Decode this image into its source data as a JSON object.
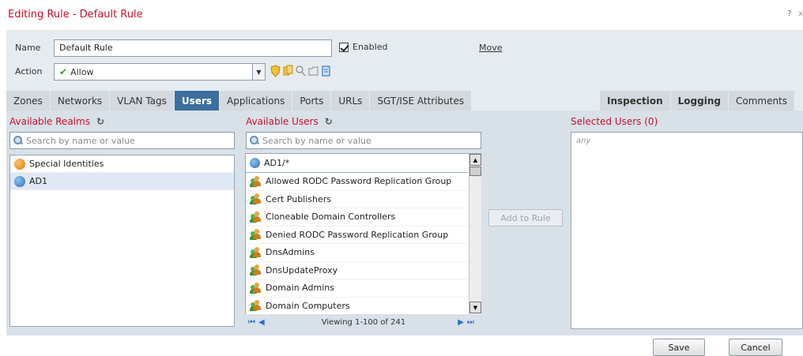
{
  "dialog": {
    "title": "Editing Rule - Default Rule",
    "help": "?",
    "close": "x"
  },
  "form": {
    "name_label": "Name",
    "name_value": "Default Rule",
    "enabled_label": "Enabled",
    "enabled_checked": true,
    "move_label": "Move",
    "action_label": "Action",
    "action_value": "Allow"
  },
  "tabs": {
    "left": [
      "Zones",
      "Networks",
      "VLAN Tags",
      "Users",
      "Applications",
      "Ports",
      "URLs",
      "SGT/ISE Attributes"
    ],
    "active": "Users",
    "right": [
      "Inspection",
      "Logging",
      "Comments"
    ]
  },
  "realms": {
    "label": "Available Realms",
    "search_placeholder": "Search by name or value",
    "items": [
      "Special Identities",
      "AD1"
    ],
    "selected": "AD1"
  },
  "users": {
    "label": "Available Users",
    "search_placeholder": "Search by name or value",
    "header_item": "AD1/*",
    "items": [
      "Allowed RODC Password Replication Group",
      "Cert Publishers",
      "Cloneable Domain Controllers",
      "Denied RODC Password Replication Group",
      "DnsAdmins",
      "DnsUpdateProxy",
      "Domain Admins",
      "Domain Computers"
    ],
    "pager_text": "Viewing 1-100 of 241"
  },
  "add_button": "Add to Rule",
  "selected": {
    "label": "Selected Users (0)",
    "placeholder": "any"
  },
  "footer": {
    "save": "Save",
    "cancel": "Cancel"
  },
  "colors": {
    "title_red": "#c8102e",
    "active_tab": "#3c6e9e",
    "panel_bg": "#d8e0e8"
  }
}
